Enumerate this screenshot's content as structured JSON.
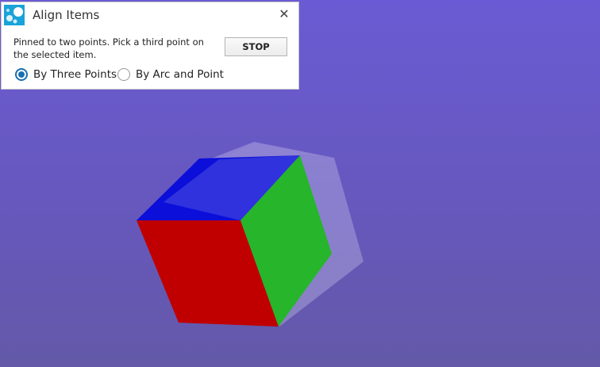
{
  "dialog": {
    "title": "Align Items",
    "icon": "align-items-app-icon",
    "close_glyph": "✕",
    "instruction": "Pinned to two points. Pick a third point on the selected item.",
    "stop_label": "STOP",
    "options": [
      {
        "label": "By Three Points",
        "selected": true
      },
      {
        "label": "By Arc and Point",
        "selected": false
      }
    ]
  },
  "scene": {
    "background_top": "#6a5bd4",
    "background_bottom": "#6359a8",
    "cube_faces": {
      "top": "#0b0fd9",
      "front": "#c00000",
      "right": "#26b52b"
    },
    "ghost_color": "#b9b1e6",
    "radio_accent": "#1a6fb0"
  }
}
